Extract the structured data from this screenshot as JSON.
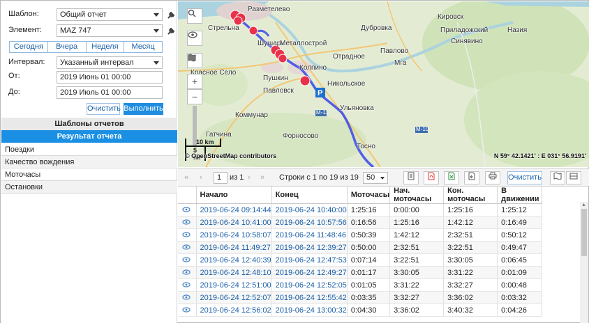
{
  "form": {
    "template_label": "Шаблон:",
    "template_value": "Общий отчет",
    "element_label": "Элемент:",
    "element_value": "MAZ 747",
    "quick_ranges": [
      "Сегодня",
      "Вчера",
      "Неделя",
      "Месяц"
    ],
    "interval_label": "Интервал:",
    "interval_value": "Указанный интервал",
    "from_label": "От:",
    "from_value": "2019 Июнь 01 00:00",
    "to_label": "До:",
    "to_value": "2019 Июль 01 00:00",
    "clear_label": "Очистить",
    "run_label": "Выполнить"
  },
  "panels": {
    "templates_header": "Шаблоны отчетов",
    "result_header": "Результат отчета"
  },
  "report_items": [
    "Поездки",
    "Качество вождения",
    "Моточасы",
    "Остановки"
  ],
  "map": {
    "labels": [
      "Стрельна",
      "Шушары",
      "Металлострой",
      "Отрадное",
      "Дубровка",
      "Павлово",
      "Мга",
      "Красное Село",
      "Пушкин",
      "Колпино",
      "Никольское",
      "Павловск",
      "Ульяновка",
      "Коммунар",
      "Гатчина",
      "Форносово",
      "Тосно",
      "Разметелево",
      "Кировск",
      "Синявино",
      "Приладожский",
      "Назия",
      "М-11",
      "М-10"
    ],
    "scale_km": "10 km",
    "scale_mi": "5 mi",
    "copyright": "© OpenStreetMap contributors",
    "coordinates": "N 59° 42.1421' : E 031° 56.9191'"
  },
  "toolbar": {
    "page_value": "1",
    "page_of": "из 1",
    "rows_info": "Строки с 1 по 19 из 19",
    "page_size": "50",
    "clear_label": "Очистить"
  },
  "table": {
    "columns": [
      "Начало",
      "Конец",
      "Моточасы",
      "Нач. моточасы",
      "Кон. моточасы",
      "В движении"
    ],
    "rows": [
      [
        "2019-06-24 09:14:44",
        "2019-06-24 10:40:00",
        "1:25:16",
        "0:00:00",
        "1:25:16",
        "1:25:12"
      ],
      [
        "2019-06-24 10:41:00",
        "2019-06-24 10:57:56",
        "0:16:56",
        "1:25:16",
        "1:42:12",
        "0:16:49"
      ],
      [
        "2019-06-24 10:58:07",
        "2019-06-24 11:48:46",
        "0:50:39",
        "1:42:12",
        "2:32:51",
        "0:50:12"
      ],
      [
        "2019-06-24 11:49:27",
        "2019-06-24 12:39:27",
        "0:50:00",
        "2:32:51",
        "3:22:51",
        "0:49:47"
      ],
      [
        "2019-06-24 12:40:39",
        "2019-06-24 12:47:53",
        "0:07:14",
        "3:22:51",
        "3:30:05",
        "0:06:45"
      ],
      [
        "2019-06-24 12:48:10",
        "2019-06-24 12:49:27",
        "0:01:17",
        "3:30:05",
        "3:31:22",
        "0:01:09"
      ],
      [
        "2019-06-24 12:51:00",
        "2019-06-24 12:52:05",
        "0:01:05",
        "3:31:22",
        "3:32:27",
        "0:00:48"
      ],
      [
        "2019-06-24 12:52:07",
        "2019-06-24 12:55:42",
        "0:03:35",
        "3:32:27",
        "3:36:02",
        "0:03:32"
      ],
      [
        "2019-06-24 12:56:02",
        "2019-06-24 13:00:32",
        "0:04:30",
        "3:36:02",
        "3:40:32",
        "0:04:26"
      ]
    ]
  }
}
